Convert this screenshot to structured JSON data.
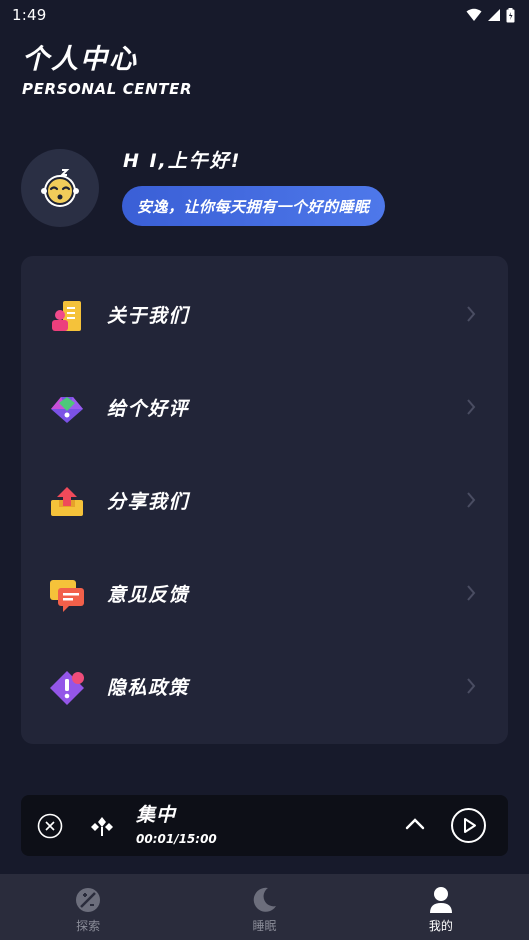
{
  "status_bar": {
    "time": "1:49"
  },
  "header": {
    "title": "个人中心",
    "subtitle": "PERSONAL CENTER"
  },
  "profile": {
    "greeting": "H I,上午好!",
    "slogan": "安逸，让你每天拥有一个好的睡眠"
  },
  "menu": {
    "items": [
      {
        "label": "关于我们",
        "icon": "about-us-icon"
      },
      {
        "label": "给个好评",
        "icon": "rate-gem-icon"
      },
      {
        "label": "分享我们",
        "icon": "share-icon"
      },
      {
        "label": "意见反馈",
        "icon": "feedback-icon"
      },
      {
        "label": "隐私政策",
        "icon": "privacy-icon"
      }
    ]
  },
  "player": {
    "title": "集中",
    "progress": "00:01/15:00"
  },
  "tabbar": {
    "tabs": [
      {
        "label": "探索",
        "icon": "explore-icon",
        "active": false
      },
      {
        "label": "睡眠",
        "icon": "moon-icon",
        "active": false
      },
      {
        "label": "我的",
        "icon": "profile-icon",
        "active": true
      }
    ]
  },
  "colors": {
    "background": "#171a2b",
    "card": "#222538",
    "accent_blue": "#4468e0",
    "player_bg": "#0d0f17",
    "tabbar_bg": "#2a2c3c"
  }
}
